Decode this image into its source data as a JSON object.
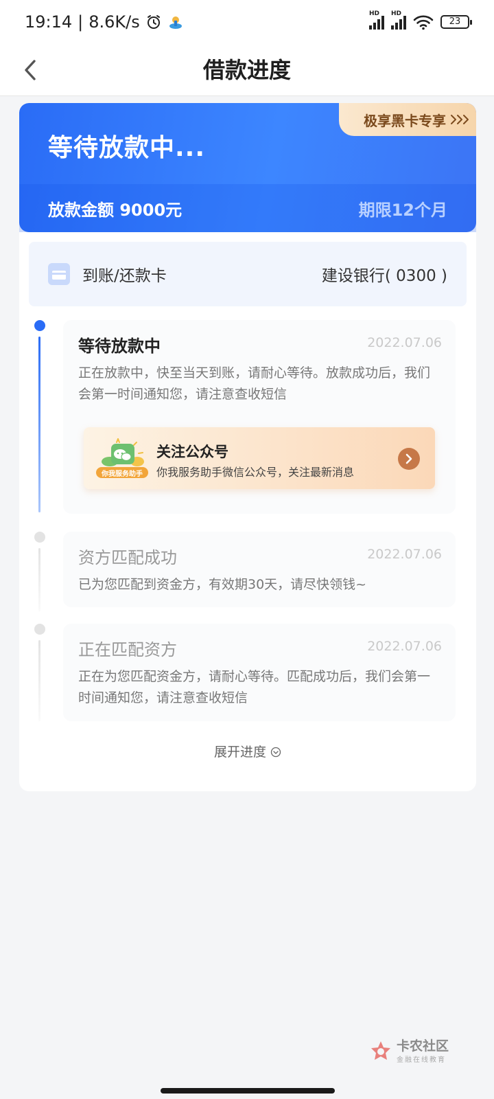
{
  "status_bar": {
    "time": "19:14",
    "net_speed": "8.6K/s",
    "hd_label": "HD",
    "battery": "23"
  },
  "nav": {
    "title": "借款进度"
  },
  "hero": {
    "status": "等待放款中...",
    "amount_label": "放款金额 9000元",
    "term_label": "期限12个月",
    "vip_badge": "极享黑卡专享"
  },
  "bank_card": {
    "label": "到账/还款卡",
    "value": "建设银行( 0300 )"
  },
  "timeline": [
    {
      "title": "等待放款中",
      "date": "2022.07.06",
      "desc": "正在放款中，快至当天到账，请耐心等待。放款成功后，我们会第一时间通知您，请注意查收短信",
      "active": true
    },
    {
      "title": "资方匹配成功",
      "date": "2022.07.06",
      "desc": "已为您匹配到资金方，有效期30天，请尽快领钱~",
      "active": false
    },
    {
      "title": "正在匹配资方",
      "date": "2022.07.06",
      "desc": "正在为您匹配资金方，请耐心等待。匹配成功后，我们会第一时间通知您，请注意查收短信",
      "active": false
    }
  ],
  "follow_card": {
    "title": "关注公众号",
    "subtitle": "你我服务助手微信公众号，关注最新消息",
    "art_label": "你我服务助手"
  },
  "expand_label": "展开进度",
  "watermark": {
    "name": "卡农社区",
    "tagline": "金融在线教育"
  },
  "colors": {
    "primary": "#2a6cf6",
    "inactive_dot": "#e3e3e3",
    "follow_arrow": "#c67848"
  }
}
